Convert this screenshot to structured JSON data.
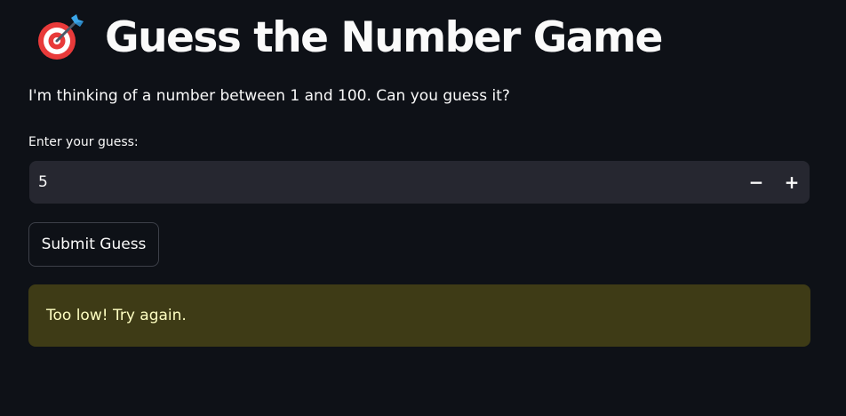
{
  "header": {
    "icon": "target-icon",
    "title": "Guess the Number Game"
  },
  "intro_text": "I'm thinking of a number between 1 and 100. Can you guess it?",
  "guess_input": {
    "label": "Enter your guess:",
    "value": "5",
    "decrement_label": "−",
    "increment_label": "+"
  },
  "submit_button": {
    "label": "Submit Guess"
  },
  "feedback": {
    "message": "Too low! Try again."
  },
  "colors": {
    "background": "#0e1117",
    "input_background": "#262730",
    "warning_background": "#3e3b16",
    "warning_text": "#ffffc2"
  }
}
